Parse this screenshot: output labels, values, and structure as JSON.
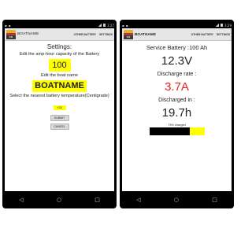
{
  "left": {
    "status": {
      "time": "3:27"
    },
    "actionbar": {
      "app_name": "BOATNAME",
      "menu": [
        "OTHER BATTERY",
        "SETTINGS"
      ]
    },
    "settings": {
      "title": "Settings:",
      "capacity_label": "Edit the amp-hour capacity of the Battery",
      "capacity_value": "100",
      "boatname_label": "Edit the boat name",
      "boatname_value": "BOATNAME",
      "temp_label": "Select the nearest battery temperature(Centigrade)",
      "temp_value": "+20",
      "submit_label": "SUBMIT",
      "cancel_label": "CANCEL"
    }
  },
  "right": {
    "status": {
      "time": "3:29"
    },
    "actionbar": {
      "app_name": "BOATNAME",
      "menu": [
        "OTHER BATTERY",
        "SETTINGS"
      ]
    },
    "battery": {
      "title": "Service Battery :100 Ah",
      "voltage": "12.3V",
      "discharge_label": "Discharge rate :",
      "discharge_value": "3.7A",
      "discharged_label": "Discharged in :",
      "discharged_value": "19.7h",
      "charged_text": "73% charged",
      "charged_fraction": 0.73
    }
  },
  "nav": {
    "back": "◁",
    "home": "○",
    "recents": "□"
  },
  "colors": {
    "accent_yellow": "#ffff00",
    "alert_red": "#e8201f",
    "screen_bg": "#000000"
  }
}
